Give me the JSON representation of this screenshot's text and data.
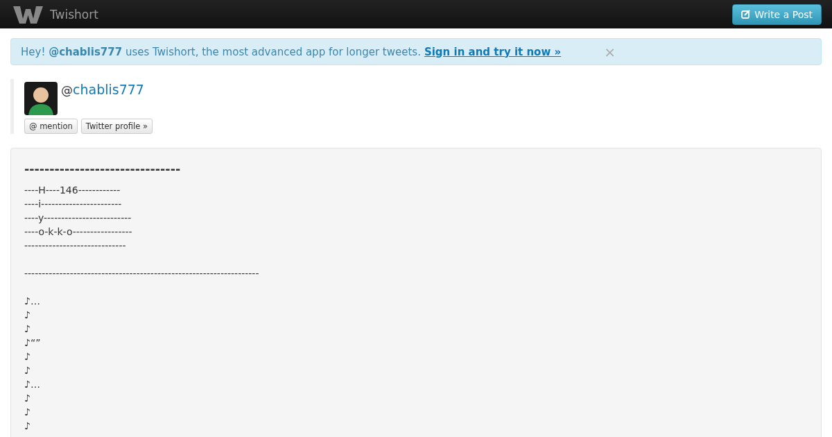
{
  "navbar": {
    "brand": "Twishort",
    "action_button": "Write a Post"
  },
  "alert": {
    "prefix": "Hey! **@chablis777** uses Twishort, the most advanced app for longer tweets.",
    "link": "Sign in and try it now »",
    "close": "×"
  },
  "profile": {
    "at": "@",
    "username": "chablis777",
    "buttons": [
      "@ mention",
      "Twitter profile »"
    ]
  },
  "post": {
    "heading": "-------------------------------",
    "paragraphs": [
      [
        "----H----146------------",
        "----i-----------------------",
        "----y-------------------------",
        "----o-k-k-o-----------------",
        "-----------------------------"
      ],
      [
        "-------------------------------------------------------------------"
      ],
      [
        "♪…",
        "♪",
        "♪",
        "♪“”",
        "♪",
        "♪",
        "♪…",
        "♪",
        "♪",
        "♪"
      ]
    ]
  }
}
